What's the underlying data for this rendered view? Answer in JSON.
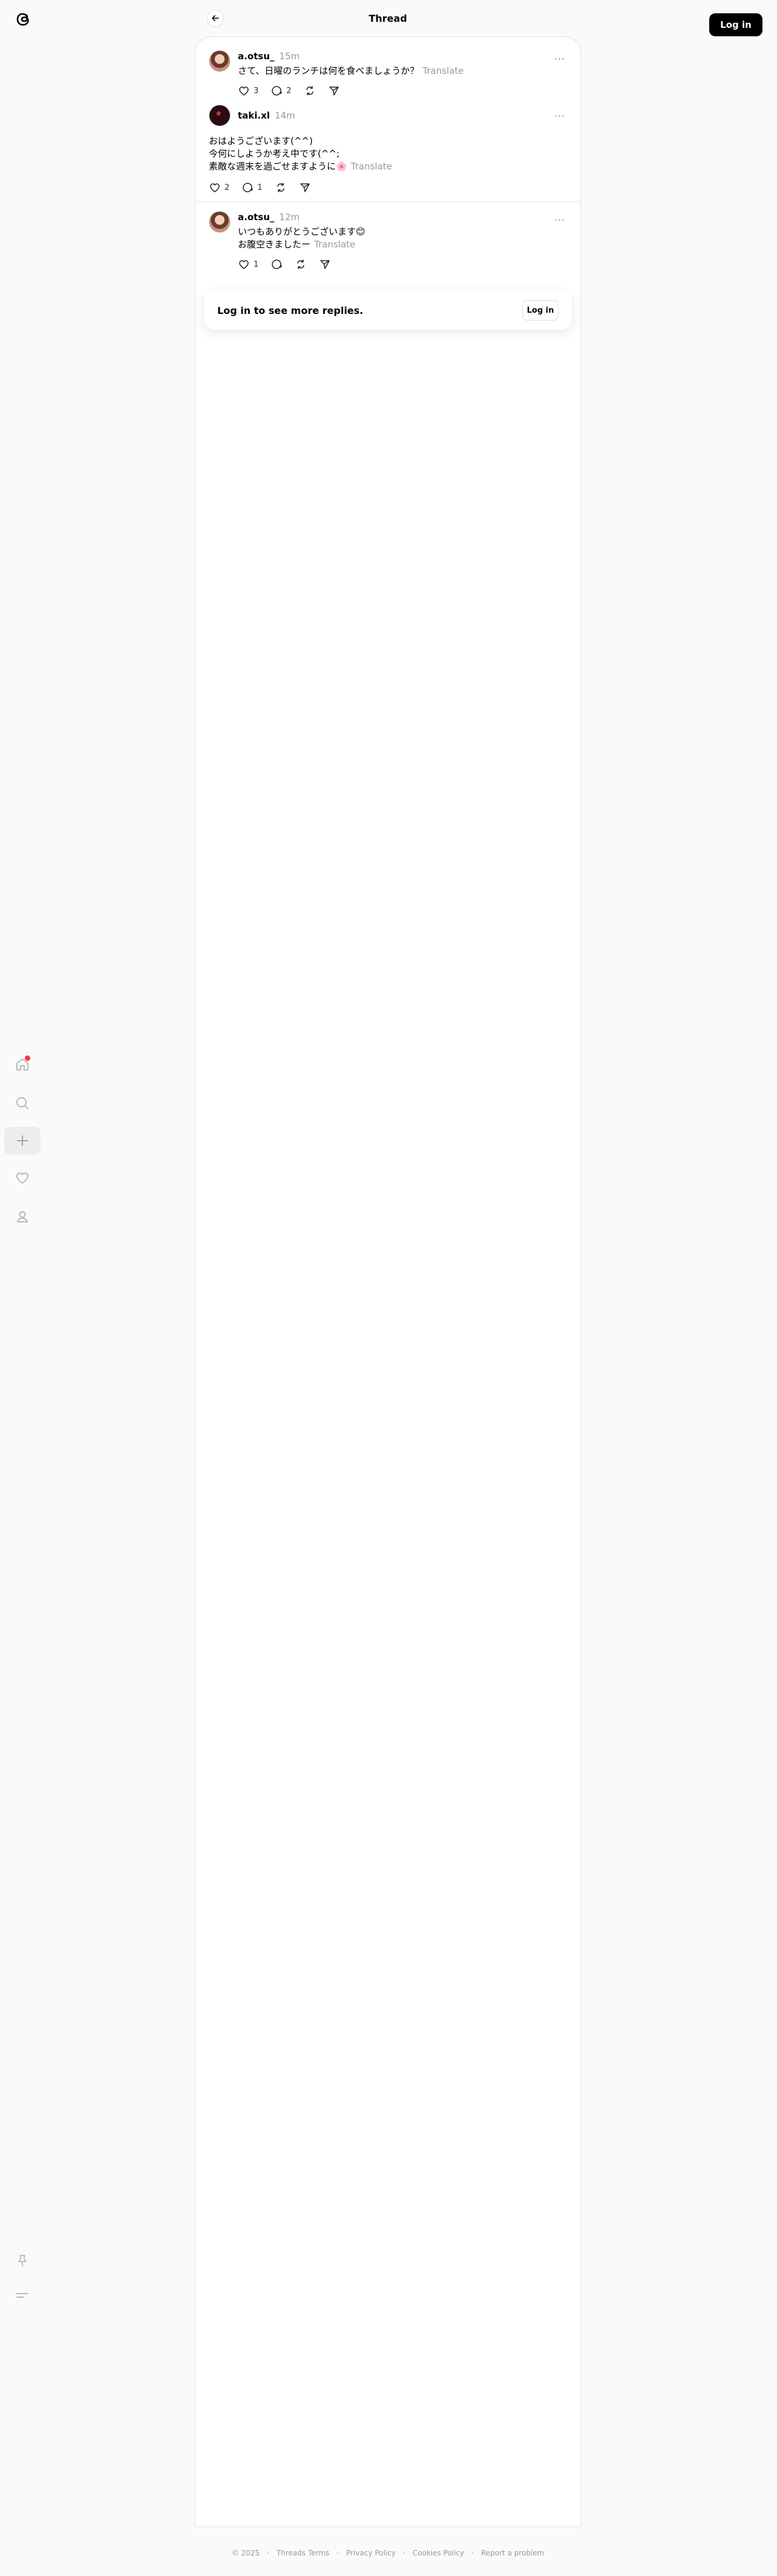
{
  "header": {
    "title": "Thread",
    "login_label": "Log in"
  },
  "icons": {
    "logo": "threads-logo-icon",
    "back": "arrow-left-icon",
    "home": "home-icon",
    "search": "search-icon",
    "create": "plus-icon",
    "activity": "heart-icon",
    "profile": "person-icon",
    "pin": "pin-icon",
    "menu": "menu-icon"
  },
  "colors": {
    "accent": "#000000",
    "notification": "#ff3040",
    "muted": "#999999"
  },
  "posts": [
    {
      "username": "a.otsu_",
      "time": "15m",
      "lines": [
        "さて、日曜のランチは何を食べましょうか？"
      ],
      "translate": "Translate",
      "likes": "3",
      "replies": "2"
    },
    {
      "username": "taki.xl",
      "time": "14m",
      "lines": [
        "おはようございます(^^)",
        "今何にしようか考え中です(^^;",
        "素敵な週末を過ごせますように🌸"
      ],
      "translate": "Translate",
      "likes": "2",
      "replies": "1"
    },
    {
      "username": "a.otsu_",
      "time": "12m",
      "lines": [
        "いつもありがとうございます😊",
        "お腹空きましたー"
      ],
      "translate": "Translate",
      "likes": "1",
      "replies": ""
    }
  ],
  "login_prompt": {
    "text": "Log in to see more replies.",
    "button": "Log in"
  },
  "footer": {
    "copyright": "© 2025",
    "links": [
      "Threads Terms",
      "Privacy Policy",
      "Cookies Policy",
      "Report a problem"
    ]
  }
}
